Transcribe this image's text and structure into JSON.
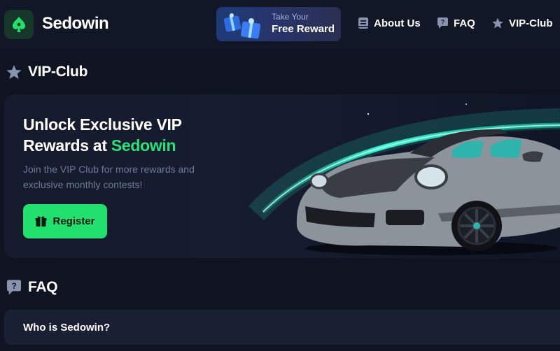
{
  "header": {
    "brand": "Sedowin",
    "reward": {
      "top": "Take Your",
      "main": "Free Reward"
    },
    "nav": [
      {
        "label": "About Us",
        "icon": "book-icon"
      },
      {
        "label": "FAQ",
        "icon": "question-chat-icon"
      },
      {
        "label": "VIP-Club",
        "icon": "star-icon"
      }
    ]
  },
  "vip": {
    "heading": "VIP-Club",
    "hero": {
      "title_line1": "Unlock Exclusive VIP",
      "title_line2_prefix": "Rewards at ",
      "title_accent": "Sedowin",
      "subtitle": "Join the VIP Club for more rewards and exclusive monthly contests!",
      "register_label": "Register"
    }
  },
  "faq": {
    "heading": "FAQ",
    "items": [
      {
        "question": "Who is Sedowin?"
      }
    ]
  },
  "colors": {
    "accent": "#22e06d",
    "background": "#0f1322",
    "card": "#1a2033"
  }
}
